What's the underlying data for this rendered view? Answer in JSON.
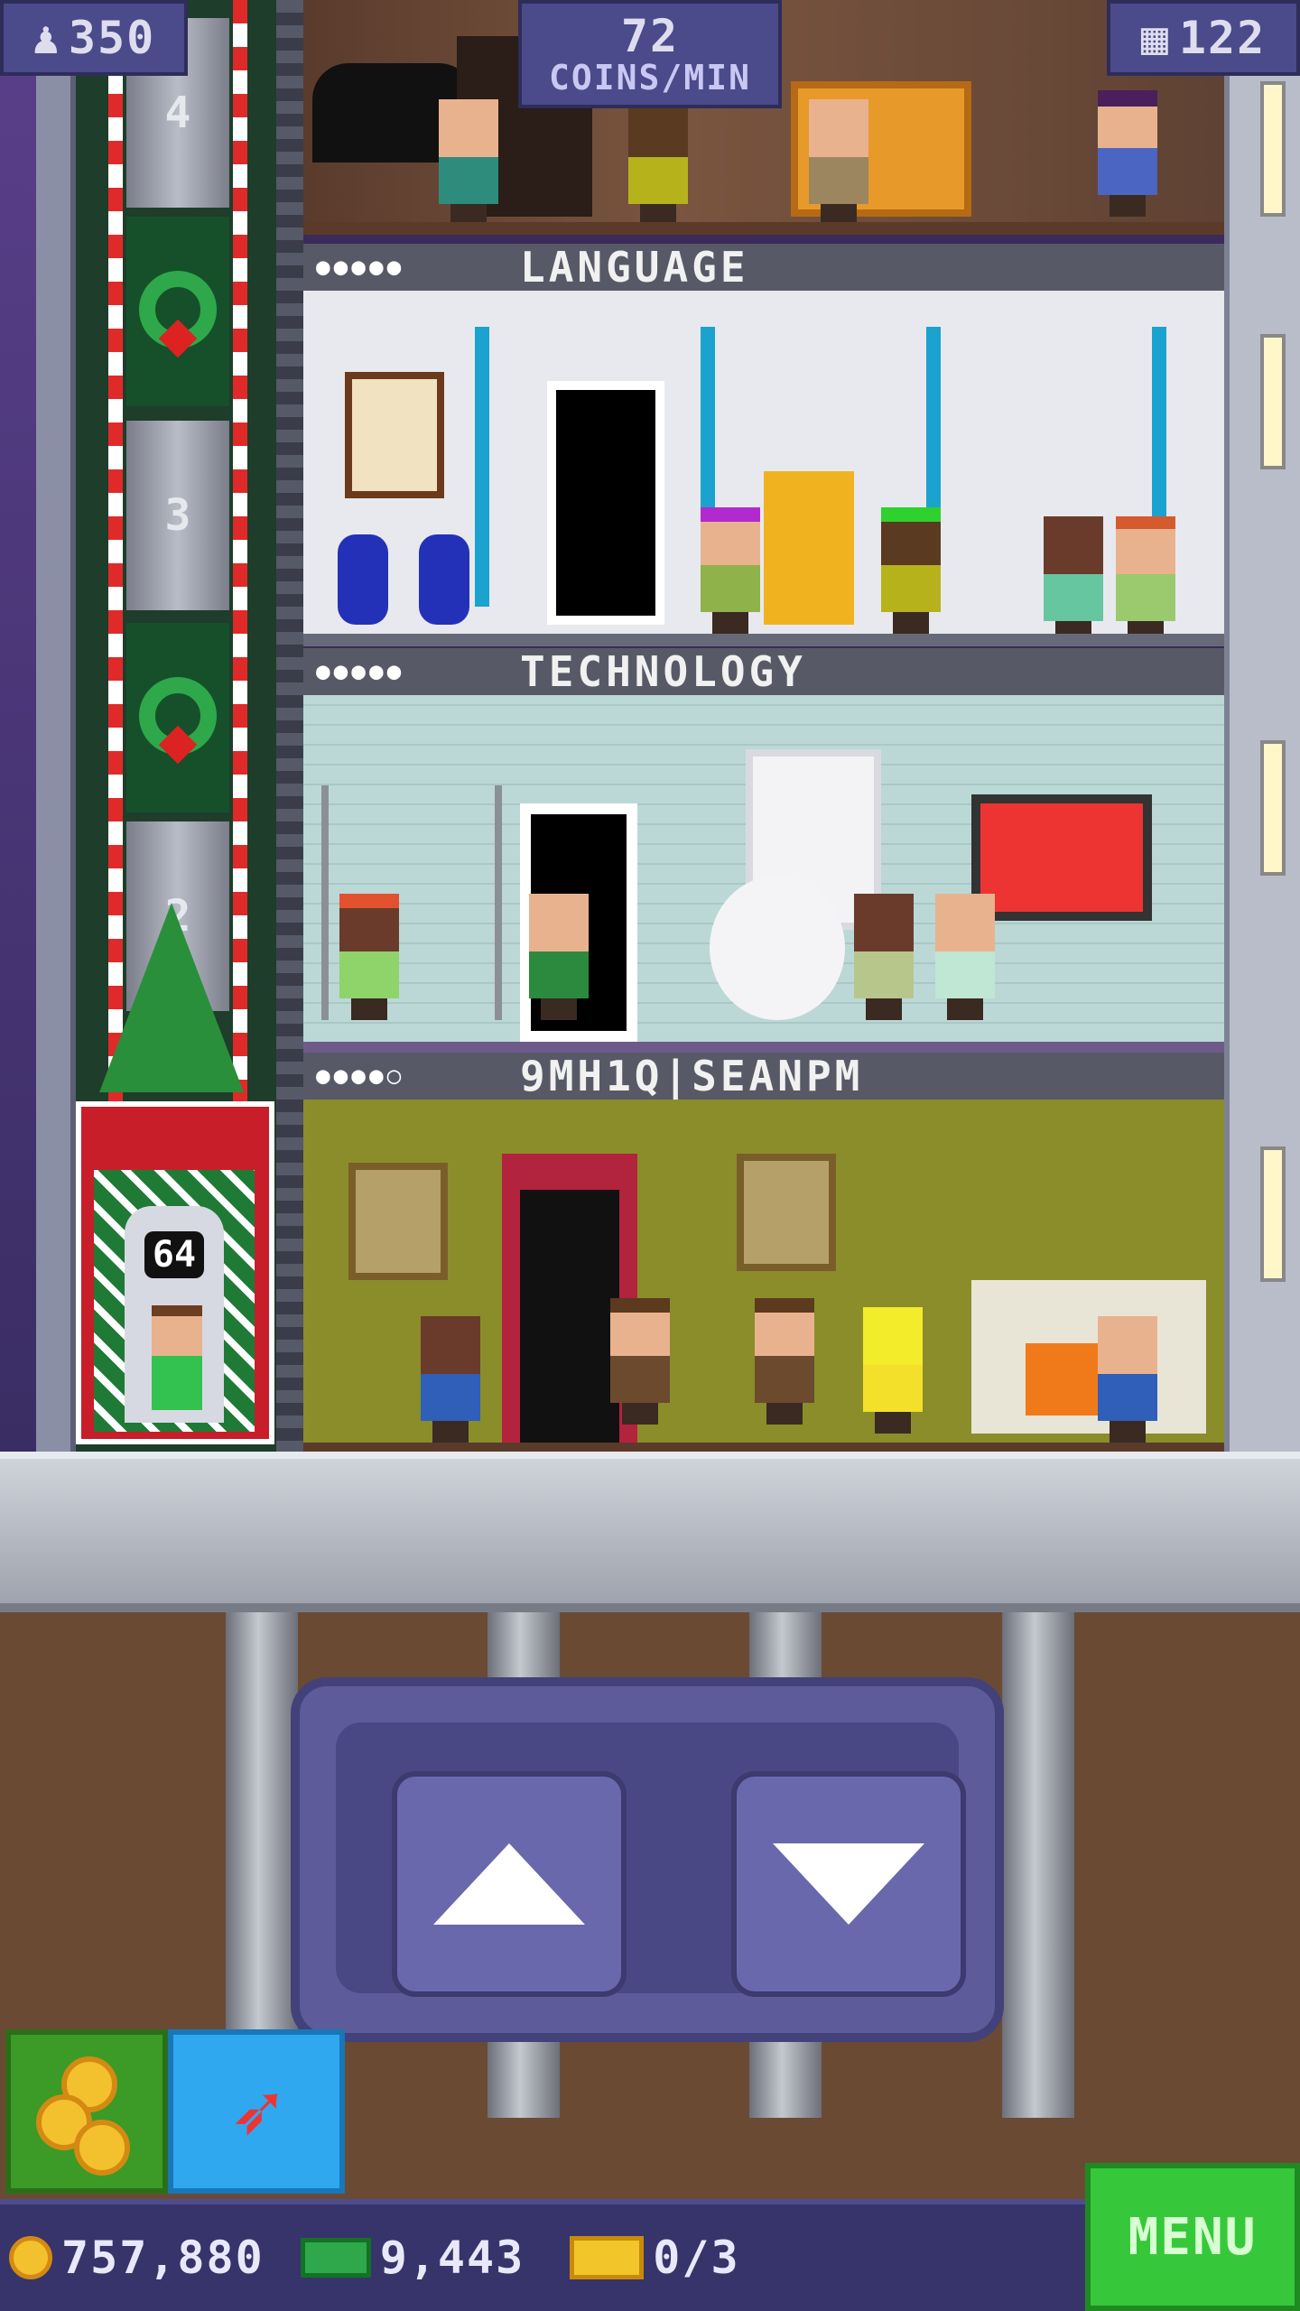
{
  "hud": {
    "population": "350",
    "population_icon": "person-icon",
    "coin_rate_value": "72",
    "coin_rate_unit": "COINS/MIN",
    "floor_count": "122",
    "floor_count_icon": "building-icon"
  },
  "shaft": {
    "floor_numbers": [
      "4",
      "3",
      "2"
    ],
    "elevator_badge": "64"
  },
  "floors": [
    {
      "name": "",
      "stars": ""
    },
    {
      "name": "LANGUAGE",
      "stars": "●●●●●"
    },
    {
      "name": "TECHNOLOGY",
      "stars": "●●●●●"
    },
    {
      "name": "9MH1Q|SEANPM",
      "stars": "●●●●○"
    }
  ],
  "controls": {
    "up_icon": "arrow-up-icon",
    "down_icon": "arrow-down-icon",
    "coins_icon": "coins-icon",
    "boost_icon": "boost-arrow-icon"
  },
  "bottom_bar": {
    "coins": "757,880",
    "bux": "9,443",
    "tickets": "0/3",
    "menu_label": "MENU"
  },
  "colors": {
    "menu": "#36c83a",
    "hud": "#4b4a8a",
    "controls": "#5d5b9a"
  }
}
